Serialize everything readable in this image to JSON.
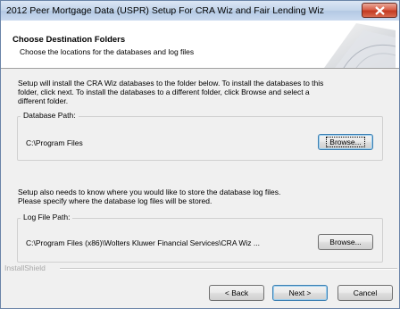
{
  "window": {
    "title": "2012 Peer Mortgage Data (USPR) Setup For CRA Wiz and Fair Lending Wiz"
  },
  "header": {
    "title": "Choose Destination Folders",
    "subtitle": "Choose the locations for the databases and log files"
  },
  "intro": {
    "line1": "Setup will install the CRA Wiz databases to the folder below.  To install the databases to this",
    "line2": "folder, click next.  To install the databases to a different folder, click Browse and select a",
    "line3": "different folder."
  },
  "database": {
    "label": "Database Path:",
    "path": "C:\\Program Files",
    "browse_label": "Browse..."
  },
  "log_intro": {
    "line1": "Setup also needs to know where you would like to store the database log files.",
    "line2": "Please specify where the database log files will be stored."
  },
  "log": {
    "label": "Log File Path:",
    "path": "C:\\Program Files (x86)\\Wolters Kluwer Financial Services\\CRA Wiz ...",
    "browse_label": "Browse..."
  },
  "footer": {
    "brand": "InstallShield",
    "back_label": "< Back",
    "next_label": "Next >",
    "cancel_label": "Cancel"
  }
}
